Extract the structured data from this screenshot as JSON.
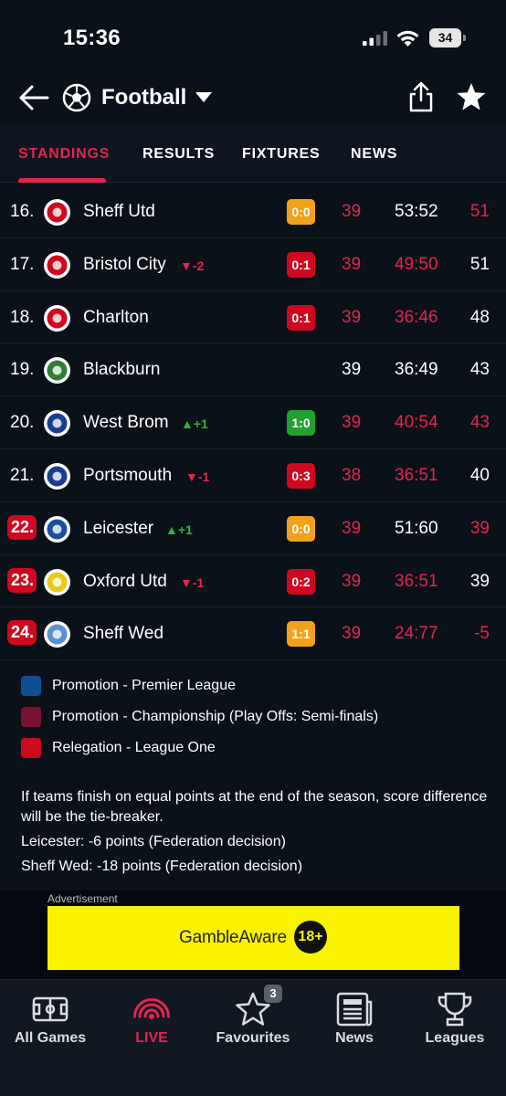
{
  "status_bar": {
    "time": "15:36",
    "battery": "34"
  },
  "header": {
    "title": "Football"
  },
  "tabs": [
    {
      "label": "STANDINGS",
      "active": true
    },
    {
      "label": "RESULTS",
      "active": false
    },
    {
      "label": "FIXTURES",
      "active": false
    },
    {
      "label": "NEWS",
      "active": false
    }
  ],
  "standings": [
    {
      "pos": "16.",
      "team": "Sheff Utd",
      "change": "",
      "score": "0:0",
      "result": "draw",
      "played": "39",
      "goals": "53:52",
      "points": "51",
      "relegation": false,
      "played_red": true,
      "goals_red": false,
      "points_red": true
    },
    {
      "pos": "17.",
      "team": "Bristol City",
      "change": "-2",
      "score": "0:1",
      "result": "loss",
      "played": "39",
      "goals": "49:50",
      "points": "51",
      "relegation": false,
      "played_red": true,
      "goals_red": true,
      "points_red": false
    },
    {
      "pos": "18.",
      "team": "Charlton",
      "change": "",
      "score": "0:1",
      "result": "loss",
      "played": "39",
      "goals": "36:46",
      "points": "48",
      "relegation": false,
      "played_red": true,
      "goals_red": true,
      "points_red": false
    },
    {
      "pos": "19.",
      "team": "Blackburn",
      "change": "",
      "score": "",
      "result": "",
      "played": "39",
      "goals": "36:49",
      "points": "43",
      "relegation": false,
      "played_red": false,
      "goals_red": false,
      "points_red": false
    },
    {
      "pos": "20.",
      "team": "West Brom",
      "change": "+1",
      "score": "1:0",
      "result": "win",
      "played": "39",
      "goals": "40:54",
      "points": "43",
      "relegation": false,
      "played_red": true,
      "goals_red": true,
      "points_red": true
    },
    {
      "pos": "21.",
      "team": "Portsmouth",
      "change": "-1",
      "score": "0:3",
      "result": "loss",
      "played": "38",
      "goals": "36:51",
      "points": "40",
      "relegation": false,
      "played_red": true,
      "goals_red": true,
      "points_red": false
    },
    {
      "pos": "22.",
      "team": "Leicester",
      "change": "+1",
      "score": "0:0",
      "result": "draw",
      "played": "39",
      "goals": "51:60",
      "points": "39",
      "relegation": true,
      "played_red": true,
      "goals_red": false,
      "points_red": true
    },
    {
      "pos": "23.",
      "team": "Oxford Utd",
      "change": "-1",
      "score": "0:2",
      "result": "loss",
      "played": "39",
      "goals": "36:51",
      "points": "39",
      "relegation": true,
      "played_red": true,
      "goals_red": true,
      "points_red": false
    },
    {
      "pos": "24.",
      "team": "Sheff Wed",
      "change": "",
      "score": "1:1",
      "result": "draw",
      "played": "39",
      "goals": "24:77",
      "points": "-5",
      "relegation": true,
      "played_red": true,
      "goals_red": true,
      "points_red": true
    }
  ],
  "legend": [
    {
      "label": "Promotion - Premier League",
      "color": "#0e4f93"
    },
    {
      "label": "Promotion - Championship (Play Offs: Semi-finals)",
      "color": "#7b1035"
    },
    {
      "label": "Relegation - League One",
      "color": "#d0081f"
    }
  ],
  "notes": {
    "tiebreak": "If teams finish on equal points at the end of the season, score difference will be the tie-breaker.",
    "deduction_1": "Leicester: -6 points (Federation decision)",
    "deduction_2": "Sheff Wed: -18 points (Federation decision)"
  },
  "ad": {
    "label": "Advertisement",
    "brand": "GambleAware",
    "age": "18+"
  },
  "bottom_nav": [
    {
      "label": "All Games",
      "icon": "pitch-icon",
      "active": false,
      "badge": ""
    },
    {
      "label": "LIVE",
      "icon": "live-icon",
      "active": true,
      "badge": ""
    },
    {
      "label": "Favourites",
      "icon": "star-outline-icon",
      "active": false,
      "badge": "3"
    },
    {
      "label": "News",
      "icon": "news-icon",
      "active": false,
      "badge": ""
    },
    {
      "label": "Leagues",
      "icon": "trophy-icon",
      "active": false,
      "badge": ""
    }
  ],
  "colors": {
    "accent": "#e5254d",
    "background": "#0b1119",
    "win": "#22a030",
    "draw": "#f2a21a",
    "loss": "#d0081f"
  }
}
